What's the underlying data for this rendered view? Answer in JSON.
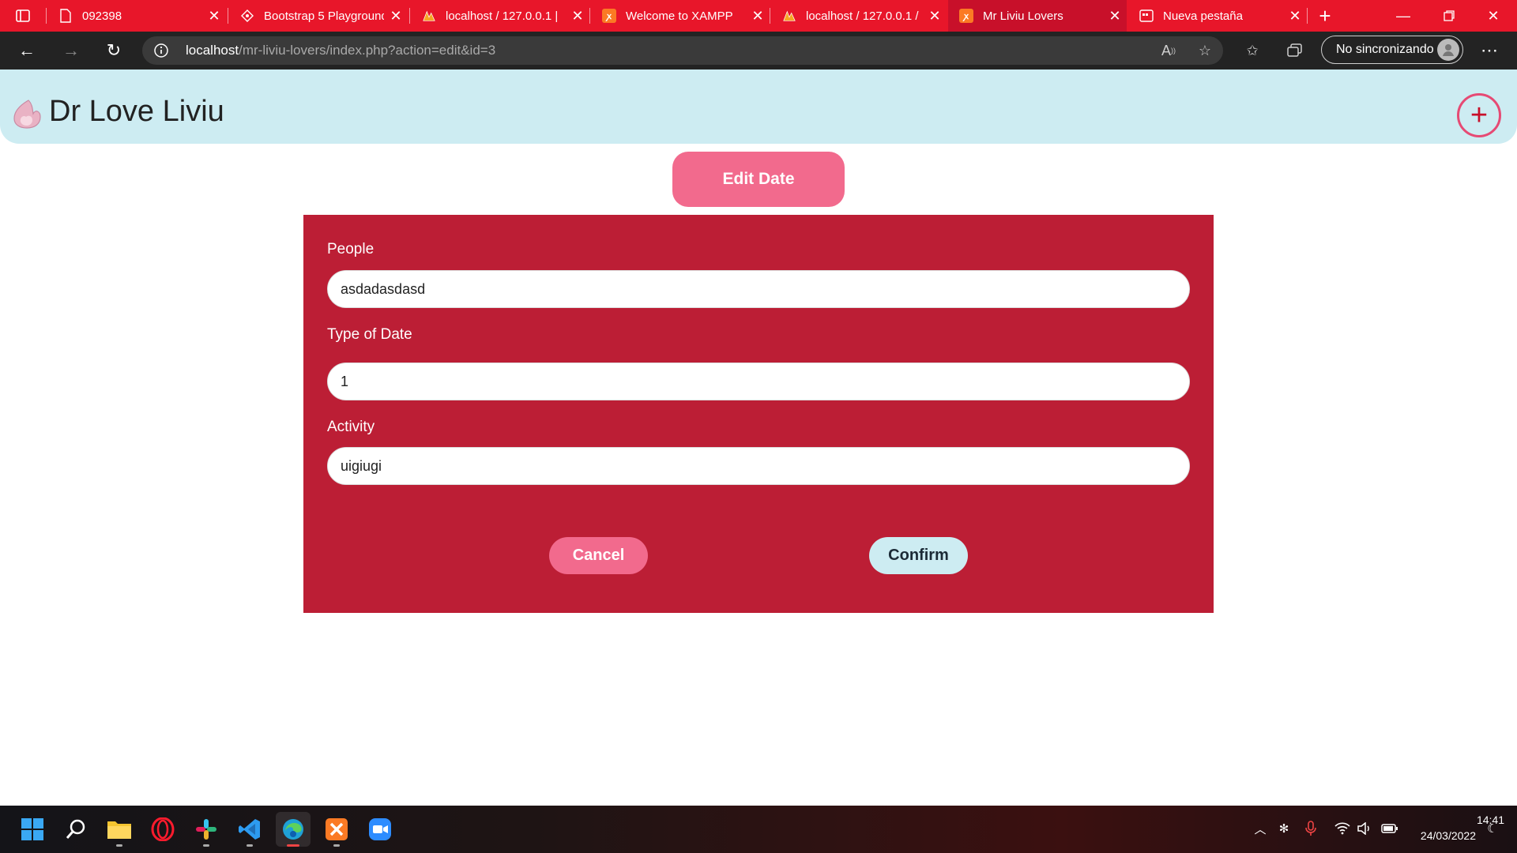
{
  "browser": {
    "tabs": [
      {
        "title": "092398",
        "icon": "document-icon"
      },
      {
        "title": "Bootstrap 5 Playground",
        "icon": "bootstrap-icon"
      },
      {
        "title": "localhost / 127.0.0.1 |",
        "icon": "phpmyadmin-icon"
      },
      {
        "title": "Welcome to XAMPP",
        "icon": "xampp-icon"
      },
      {
        "title": "localhost / 127.0.0.1 /",
        "icon": "phpmyadmin-icon"
      },
      {
        "title": "Mr Liviu Lovers",
        "icon": "xampp-icon",
        "active": true
      },
      {
        "title": "Nueva pestaña",
        "icon": "new-tab-icon"
      }
    ],
    "address": {
      "host": "localhost",
      "path": "/mr-liviu-lovers/index.php?action=edit&id=3"
    },
    "profile_label": "No sincronizando"
  },
  "header": {
    "brand": "Dr Love Liviu"
  },
  "page": {
    "title_button": "Edit Date",
    "fields": {
      "people": {
        "label": "People",
        "value": "asdadasdasd"
      },
      "type": {
        "label": "Type of Date",
        "value": "1"
      },
      "activity": {
        "label": "Activity",
        "value": "uigiugi"
      }
    },
    "cancel_label": "Cancel",
    "confirm_label": "Confirm"
  },
  "taskbar": {
    "apps": [
      "windows-start-icon",
      "search-icon",
      "file-explorer-icon",
      "opera-icon",
      "slack-icon",
      "vscode-icon",
      "edge-icon",
      "xampp-icon",
      "zoom-icon"
    ],
    "time": "14:41",
    "date": "24/03/2022"
  },
  "colors": {
    "tab_bar": "#e8162a",
    "header_bg": "#cdecf2",
    "panel_bg": "#bc1e35",
    "pink_button": "#f26a8d",
    "confirm_bg": "#cdecf2"
  }
}
